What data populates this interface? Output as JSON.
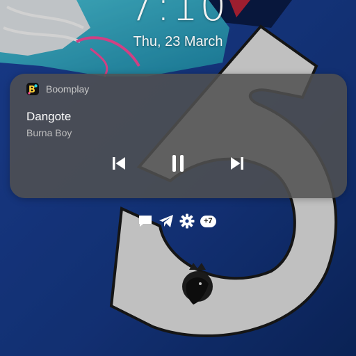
{
  "lockscreen": {
    "time": "7:10",
    "date": "Thu, 23 March"
  },
  "media": {
    "app_name": "Boomplay",
    "app_icon": "boomplay-icon",
    "track_title": "Dangote",
    "artist": "Burna Boy",
    "controls": [
      "skip-previous-icon",
      "pause-icon",
      "skip-next-icon"
    ]
  },
  "notifications": {
    "icons": [
      "message-icon",
      "telegram-icon",
      "settings-gear-icon"
    ],
    "more_count": "+7"
  },
  "wallpaper": {
    "description_colors": {
      "jersey": "#173a8c",
      "number": "#e9e9e9",
      "shoe": "#2fb4d0",
      "laces": "#ff4fa0"
    }
  }
}
